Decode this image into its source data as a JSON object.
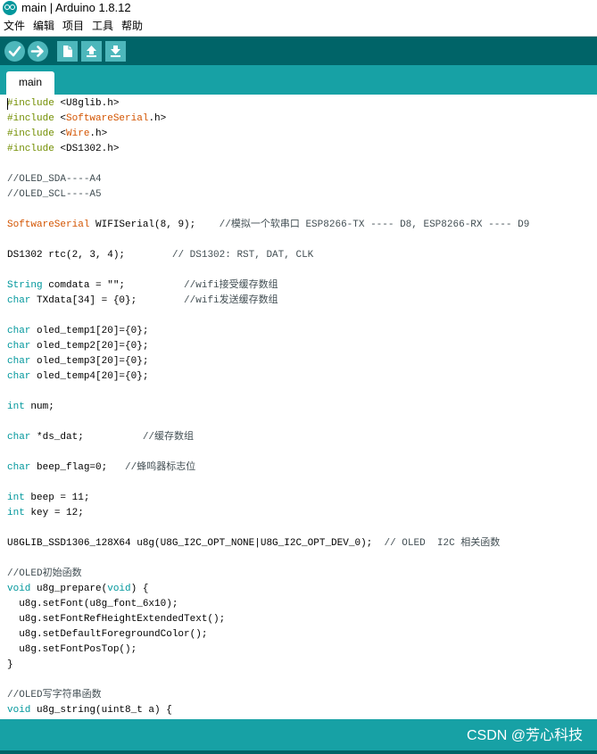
{
  "window": {
    "title": "main | Arduino 1.8.12"
  },
  "menu": [
    "文件",
    "编辑",
    "项目",
    "工具",
    "帮助"
  ],
  "toolbar": {
    "buttons": [
      {
        "name": "verify",
        "icon": "check-icon"
      },
      {
        "name": "upload",
        "icon": "arrow-right-icon"
      },
      {
        "name": "new",
        "icon": "new-file-icon"
      },
      {
        "name": "open",
        "icon": "arrow-up-icon"
      },
      {
        "name": "save",
        "icon": "arrow-down-icon"
      }
    ]
  },
  "tabs": [
    {
      "label": "main",
      "active": true
    }
  ],
  "editor": {
    "lines": [
      [
        {
          "t": "#include",
          "c": "kw"
        },
        {
          "t": " <U8glib.h>",
          "c": ""
        }
      ],
      [
        {
          "t": "#include",
          "c": "kw"
        },
        {
          "t": " <",
          "c": ""
        },
        {
          "t": "SoftwareSerial",
          "c": "lib"
        },
        {
          "t": ".h>",
          "c": ""
        }
      ],
      [
        {
          "t": "#include",
          "c": "kw"
        },
        {
          "t": " <",
          "c": ""
        },
        {
          "t": "Wire",
          "c": "lib"
        },
        {
          "t": ".h>",
          "c": ""
        }
      ],
      [
        {
          "t": "#include",
          "c": "kw"
        },
        {
          "t": " <DS1302.h>",
          "c": ""
        }
      ],
      [],
      [
        {
          "t": "//OLED_SDA----A4",
          "c": "cm"
        }
      ],
      [
        {
          "t": "//OLED_SCL----A5",
          "c": "cm"
        }
      ],
      [],
      [
        {
          "t": "SoftwareSerial",
          "c": "lib"
        },
        {
          "t": " WIFISerial(8, 9);    ",
          "c": ""
        },
        {
          "t": "//模拟一个软串口 ESP8266-TX ---- D8, ESP8266-RX ---- D9",
          "c": "cm"
        }
      ],
      [],
      [
        {
          "t": "DS1302 rtc(2, 3, 4);        ",
          "c": ""
        },
        {
          "t": "// DS1302: RST, DAT, CLK",
          "c": "cm"
        }
      ],
      [],
      [
        {
          "t": "String",
          "c": "ty"
        },
        {
          "t": " comdata = \"\";          ",
          "c": ""
        },
        {
          "t": "//wifi接受缓存数组",
          "c": "cm"
        }
      ],
      [
        {
          "t": "char",
          "c": "ty"
        },
        {
          "t": " TXdata[34] = {0};        ",
          "c": ""
        },
        {
          "t": "//wifi发送缓存数组",
          "c": "cm"
        }
      ],
      [],
      [
        {
          "t": "char",
          "c": "ty"
        },
        {
          "t": " oled_temp1[20]={0};",
          "c": ""
        }
      ],
      [
        {
          "t": "char",
          "c": "ty"
        },
        {
          "t": " oled_temp2[20]={0};",
          "c": ""
        }
      ],
      [
        {
          "t": "char",
          "c": "ty"
        },
        {
          "t": " oled_temp3[20]={0};",
          "c": ""
        }
      ],
      [
        {
          "t": "char",
          "c": "ty"
        },
        {
          "t": " oled_temp4[20]={0};",
          "c": ""
        }
      ],
      [],
      [
        {
          "t": "int",
          "c": "ty"
        },
        {
          "t": " num;",
          "c": ""
        }
      ],
      [],
      [
        {
          "t": "char",
          "c": "ty"
        },
        {
          "t": " *ds_dat;          ",
          "c": ""
        },
        {
          "t": "//缓存数组",
          "c": "cm"
        }
      ],
      [],
      [
        {
          "t": "char",
          "c": "ty"
        },
        {
          "t": " beep_flag=0;   ",
          "c": ""
        },
        {
          "t": "//蜂鸣器标志位",
          "c": "cm"
        }
      ],
      [],
      [
        {
          "t": "int",
          "c": "ty"
        },
        {
          "t": " beep = 11;",
          "c": ""
        }
      ],
      [
        {
          "t": "int",
          "c": "ty"
        },
        {
          "t": " key = 12;",
          "c": ""
        }
      ],
      [],
      [
        {
          "t": "U8GLIB_SSD1306_128X64 u8g(U8G_I2C_OPT_NONE|U8G_I2C_OPT_DEV_0);  ",
          "c": ""
        },
        {
          "t": "// OLED  I2C 相关函数",
          "c": "cm"
        }
      ],
      [],
      [
        {
          "t": "//OLED初始函数",
          "c": "cm"
        }
      ],
      [
        {
          "t": "void",
          "c": "ty"
        },
        {
          "t": " u8g_prepare(",
          "c": ""
        },
        {
          "t": "void",
          "c": "ty"
        },
        {
          "t": ") {",
          "c": ""
        }
      ],
      [
        {
          "t": "  u8g.setFont(u8g_font_6x10);",
          "c": ""
        }
      ],
      [
        {
          "t": "  u8g.setFontRefHeightExtendedText();",
          "c": ""
        }
      ],
      [
        {
          "t": "  u8g.setDefaultForegroundColor();",
          "c": ""
        }
      ],
      [
        {
          "t": "  u8g.setFontPosTop();",
          "c": ""
        }
      ],
      [
        {
          "t": "}",
          "c": ""
        }
      ],
      [],
      [
        {
          "t": "//OLED写字符串函数",
          "c": "cm"
        }
      ],
      [
        {
          "t": "void",
          "c": "ty"
        },
        {
          "t": " u8g_string(uint8_t a) {",
          "c": ""
        }
      ]
    ]
  },
  "status": {
    "watermark": "CSDN @芳心科技"
  },
  "colors": {
    "toolbar": "#006468",
    "tabstrip": "#17a1a5",
    "keyword": "#728e00",
    "type": "#00979c",
    "library": "#d35400",
    "comment": "#434f54"
  }
}
